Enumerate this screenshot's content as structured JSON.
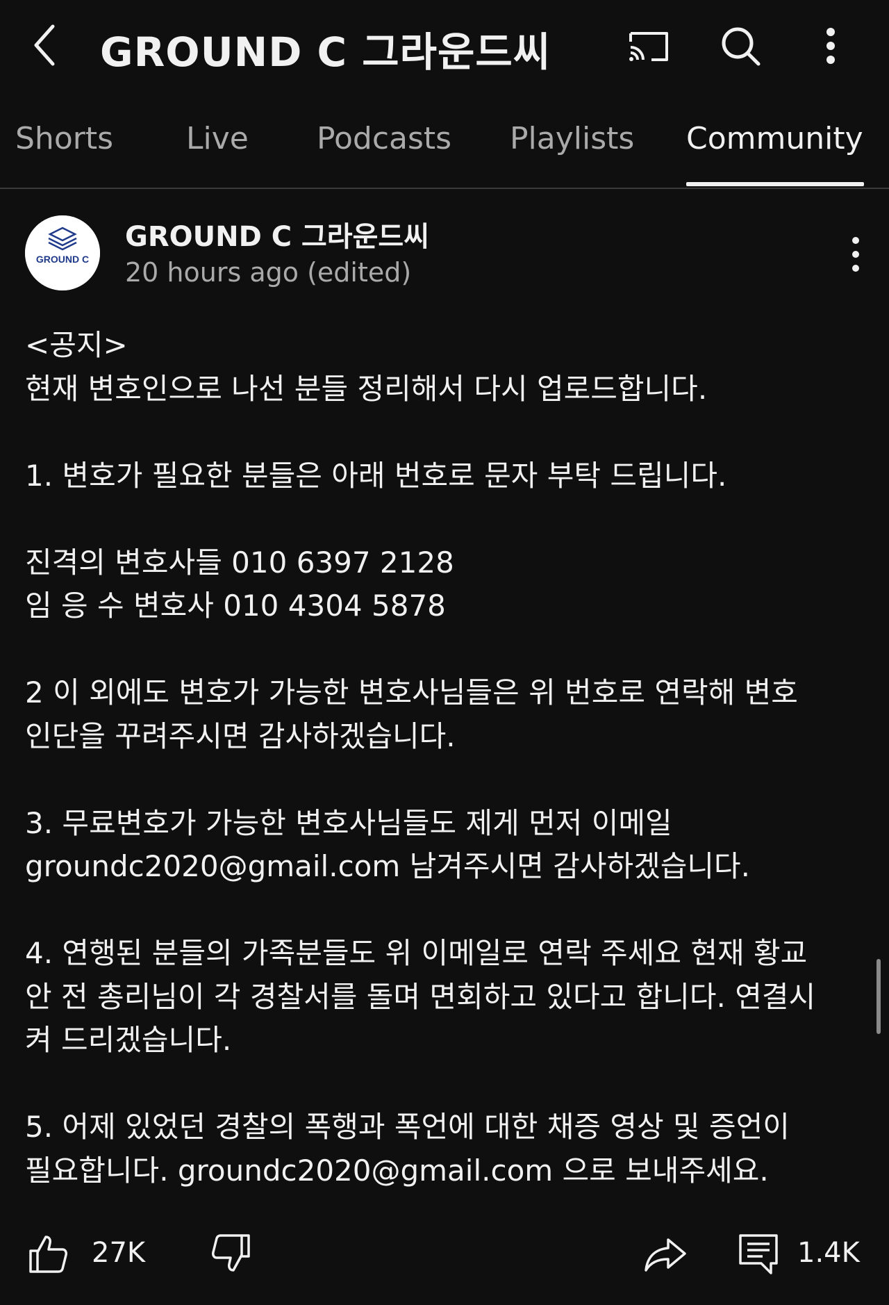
{
  "header": {
    "title": "GROUND C 그라운드씨",
    "icons": [
      "back-arrow-icon",
      "cast-icon",
      "search-icon",
      "more-vertical-icon"
    ]
  },
  "tabs": [
    {
      "label": "Shorts",
      "active": false
    },
    {
      "label": "Live",
      "active": false
    },
    {
      "label": "Podcasts",
      "active": false
    },
    {
      "label": "Playlists",
      "active": false
    },
    {
      "label": "Community",
      "active": true
    }
  ],
  "post": {
    "channel_name": "GROUND C 그라운드씨",
    "avatar_text": "GROUND C",
    "time": "20 hours ago (edited)",
    "body_lines": [
      "<공지>",
      "현재 변호인으로 나선 분들 정리해서 다시 업로드합니다.",
      "",
      "1. 변호가 필요한 분들은 아래 번호로 문자 부탁 드립니다.",
      "",
      "진격의 변호사들 010 6397 2128",
      "임 응 수 변호사 010 4304 5878",
      "",
      "2 이 외에도 변호가 가능한 변호사님들은 위 번호로 연락해 변호",
      "인단을 꾸려주시면 감사하겠습니다.",
      "",
      "3. 무료변호가 가능한 변호사님들도 제게 먼저 이메일",
      "groundc2020@gmail.com 남겨주시면 감사하겠습니다.",
      "",
      "4. 연행된 분들의 가족분들도 위 이메일로 연락 주세요 현재 황교",
      "안 전 총리님이 각 경찰서를 돌며 면회하고 있다고 합니다. 연결시",
      "켜 드리겠습니다.",
      "",
      "5. 어제 있었던 경찰의 폭행과 폭언에 대한 채증 영상 및 증언이",
      "필요합니다. groundc2020@gmail.com 으로 보내주세요."
    ]
  },
  "actions": {
    "likes": "27K",
    "comments": "1.4K"
  },
  "colors": {
    "background": "#0f0f0f",
    "text_primary": "#f1f1f1",
    "text_secondary": "#aaaaaa",
    "logo_blue": "#1f3a8a"
  }
}
